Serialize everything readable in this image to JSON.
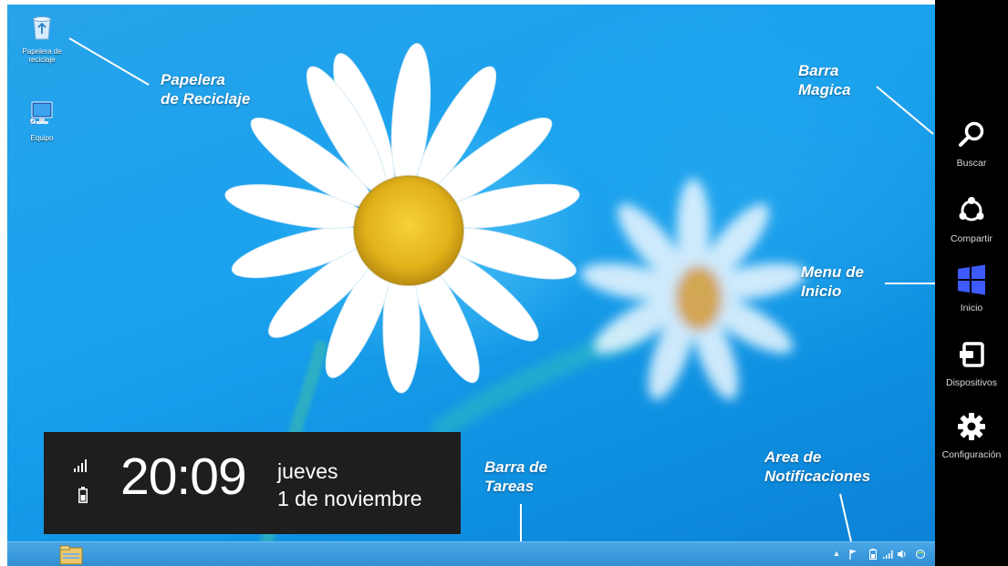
{
  "desktop": {
    "icons": [
      {
        "label": "Papelera de reciclaje",
        "icon": "recycle-bin-icon"
      },
      {
        "label": "Equipo",
        "icon": "computer-icon"
      }
    ]
  },
  "annotations": {
    "recycle_bin": {
      "line1": "Papelera",
      "line2": "de Reciclaje"
    },
    "charms_bar": {
      "line1": "Barra",
      "line2": "Magica"
    },
    "start_menu": {
      "line1": "Menu de",
      "line2": "Inicio"
    },
    "taskbar": {
      "line1": "Barra de",
      "line2": "Tareas"
    },
    "notification_area": {
      "line1": "Area de",
      "line2": "Notificaciones"
    }
  },
  "clock": {
    "time": "20:09",
    "day": "jueves",
    "date": "1 de noviembre",
    "signal_icon": "signal-bars-icon",
    "battery_icon": "battery-icon"
  },
  "charms": [
    {
      "label": "Buscar",
      "icon": "search-icon"
    },
    {
      "label": "Compartir",
      "icon": "share-icon"
    },
    {
      "label": "Inicio",
      "icon": "windows-logo-icon"
    },
    {
      "label": "Dispositivos",
      "icon": "devices-icon"
    },
    {
      "label": "Configuración",
      "icon": "settings-gear-icon"
    }
  ],
  "taskbar": {
    "pinned": [
      {
        "icon": "file-explorer-icon"
      }
    ],
    "tray_icons": [
      "show-hidden-icons-chevron",
      "action-center-flag-icon",
      "battery-icon",
      "signal-icon",
      "volume-icon",
      "network-icon"
    ]
  },
  "colors": {
    "desktop_blue": "#1aa2ee",
    "charms_bg": "#000000",
    "start_logo": "#3d5afe",
    "clock_bg": "#1e1e1e"
  }
}
